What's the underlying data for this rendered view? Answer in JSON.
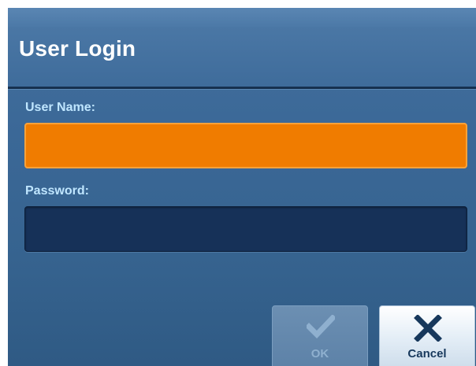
{
  "dialog": {
    "title": "User Login"
  },
  "form": {
    "username_label": "User Name:",
    "username_value": "",
    "password_label": "Password:",
    "password_value": ""
  },
  "buttons": {
    "ok_label": "OK",
    "ok_icon": "checkmark-icon",
    "ok_enabled": false,
    "cancel_label": "Cancel",
    "cancel_icon": "x-icon",
    "cancel_enabled": true
  },
  "colors": {
    "focused_field": "#f07c00",
    "panel": "#3b6897",
    "cancel_icon": "#17385c"
  }
}
